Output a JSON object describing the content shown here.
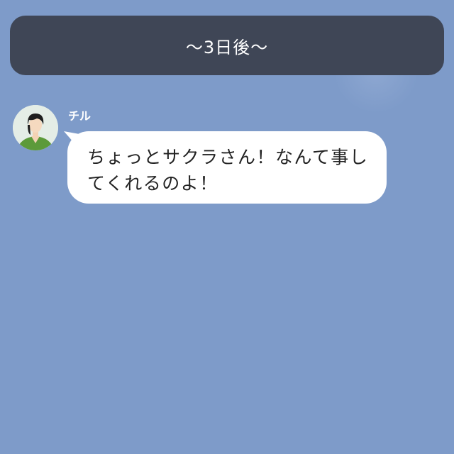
{
  "date_banner": {
    "text": "〜3日後〜"
  },
  "chat": {
    "messages": [
      {
        "sender": "チル",
        "avatar_icon": "user-avatar-icon",
        "lines": [
          "ちょっとサクラさん！なんて事し",
          "てくれるのよ！"
        ]
      }
    ]
  },
  "colors": {
    "background": "#7e9bc9",
    "banner": "#3f4656",
    "bubble": "#ffffff",
    "text": "#222222"
  }
}
